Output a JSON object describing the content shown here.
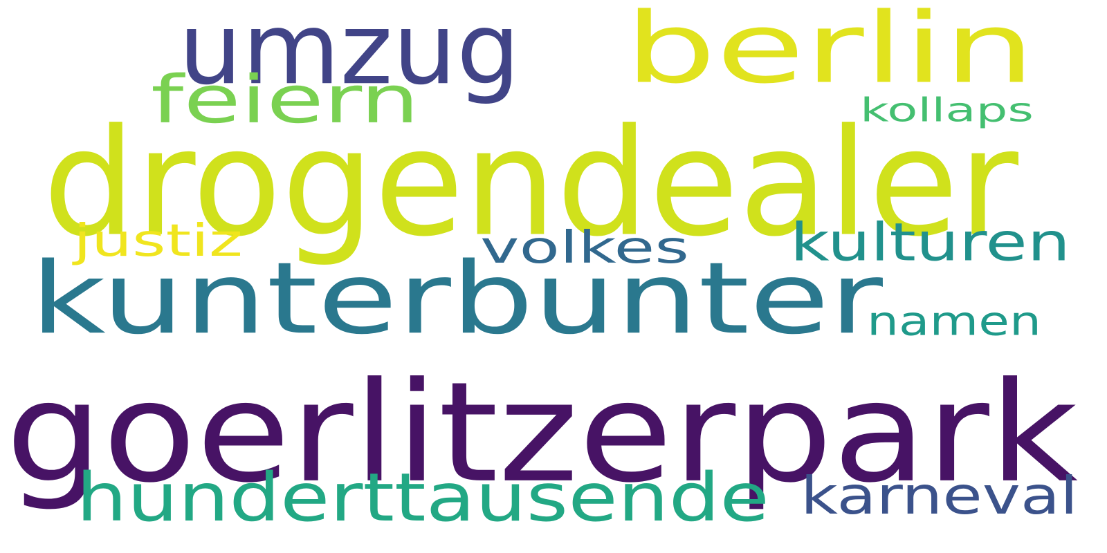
{
  "word_cloud": {
    "words": [
      {
        "text": "goerlitzerpark",
        "color": "#471365"
      },
      {
        "text": "drogendealer",
        "color": "#d0e11c"
      },
      {
        "text": "kunterbunter",
        "color": "#2a788e"
      },
      {
        "text": "umzug",
        "color": "#414487"
      },
      {
        "text": "berlin",
        "color": "#e1e31e"
      },
      {
        "text": "hunderttausende",
        "color": "#22a884"
      },
      {
        "text": "feiern",
        "color": "#7ad151"
      },
      {
        "text": "volkes",
        "color": "#31688e"
      },
      {
        "text": "kulturen",
        "color": "#21918c"
      },
      {
        "text": "namen",
        "color": "#1f9a8a"
      },
      {
        "text": "karneval",
        "color": "#3b528b"
      },
      {
        "text": "kollaps",
        "color": "#44bf70"
      },
      {
        "text": "justiz",
        "color": "#f0e51e"
      }
    ]
  }
}
